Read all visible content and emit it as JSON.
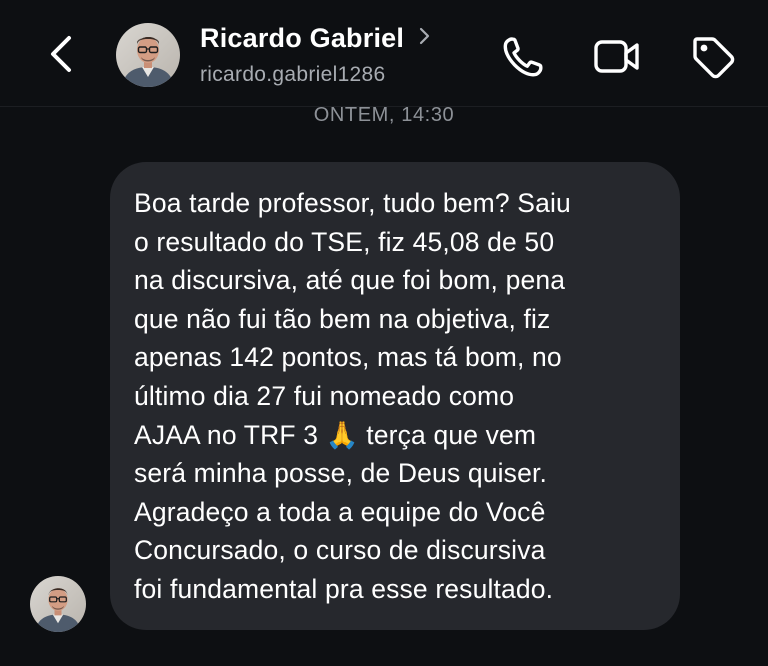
{
  "header": {
    "back_icon": "chevron-left-icon",
    "contact_name": "Ricardo Gabriel",
    "username": "ricardo.gabriel1286",
    "actions": [
      "phone-icon",
      "video-camera-icon",
      "tag-icon"
    ]
  },
  "thread": {
    "timestamp": "ONTEM, 14:30",
    "messages": [
      {
        "sender": "Ricardo Gabriel",
        "text": "Boa tarde professor, tudo bem? Saiu\no resultado do TSE, fiz 45,08 de 50\nna discursiva, até que foi bom, pena\nque não fui tão bem na objetiva, fiz\napenas 142 pontos, mas tá bom, no\núltimo dia 27 fui nomeado como\nAJAA no TRF 3 🙏  terça que vem\nserá minha posse, de Deus quiser.\nAgradeço a toda a equipe do Você\nConcursado, o curso de discursiva\nfoi fundamental pra esse resultado."
      }
    ]
  },
  "colors": {
    "background": "#0d0f12",
    "bubble": "#26282d",
    "secondary_text": "#a8acb2",
    "timestamp_text": "#8d9197"
  }
}
